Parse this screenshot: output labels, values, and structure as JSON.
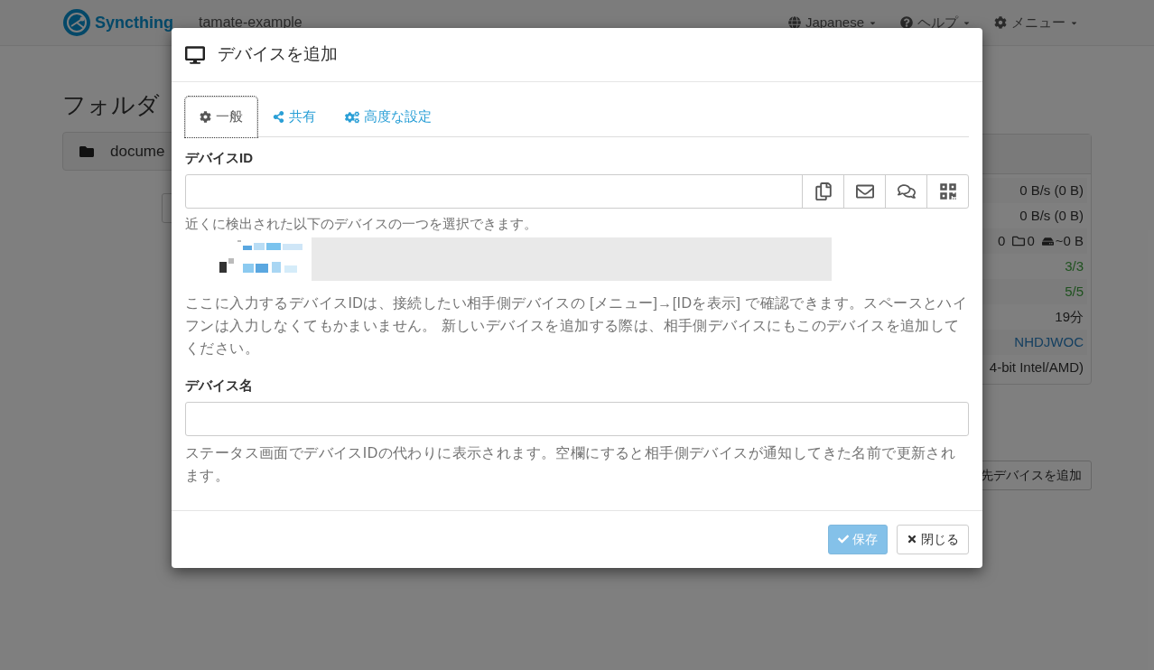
{
  "navbar": {
    "brand": "Syncthing",
    "device_name": "tamate-example",
    "menus": [
      {
        "label": "Japanese",
        "kind": "language"
      },
      {
        "label": "ヘルプ",
        "kind": "help"
      },
      {
        "label": "メニュー",
        "kind": "settings"
      }
    ]
  },
  "background": {
    "folders_heading": "フォルダ",
    "folder": {
      "name": "docume"
    },
    "device_stats": [
      {
        "kind": "text",
        "text": "0 B/s (0 B)"
      },
      {
        "kind": "text",
        "text": "0 B/s (0 B)"
      },
      {
        "kind": "counts",
        "files": "0",
        "folders": "0",
        "size": "~0 B"
      },
      {
        "kind": "success",
        "text": "3/3"
      },
      {
        "kind": "success",
        "text": "5/5"
      },
      {
        "kind": "text",
        "text": "19分"
      },
      {
        "kind": "link",
        "text": "NHDJWOC"
      },
      {
        "kind": "text",
        "text": "4-bit Intel/AMD)"
      }
    ],
    "add_button": "先デバイスを追加"
  },
  "dialog": {
    "title": "デバイスを追加",
    "tabs": [
      {
        "label": "一般",
        "kind": "general",
        "selected": true
      },
      {
        "label": "共有",
        "kind": "sharing",
        "selected": false
      },
      {
        "label": "高度な設定",
        "kind": "advanced",
        "selected": false
      }
    ],
    "device_id": {
      "label": "デバイスID"
    },
    "nearby_hint": "近くに検出された以下のデバイスの一つを選択できます。",
    "id_help": "ここに入力するデバイスIDは、接続したい相手側デバイスの [メニュー]→[IDを表示] で確認できます。スペースとハイフンは入力しなくてもかまいません。 新しいデバイスを追加する際は、相手側デバイスにもこのデバイスを追加してください。",
    "device_name": {
      "label": "デバイス名"
    },
    "name_help": "ステータス画面でデバイスIDの代わりに表示されます。空欄にすると相手側デバイスが通知してきた名前で更新されます。",
    "buttons": [
      {
        "label": "保存",
        "kind": "save",
        "disabled": true
      },
      {
        "label": "閉じる",
        "kind": "close",
        "disabled": false
      }
    ]
  }
}
